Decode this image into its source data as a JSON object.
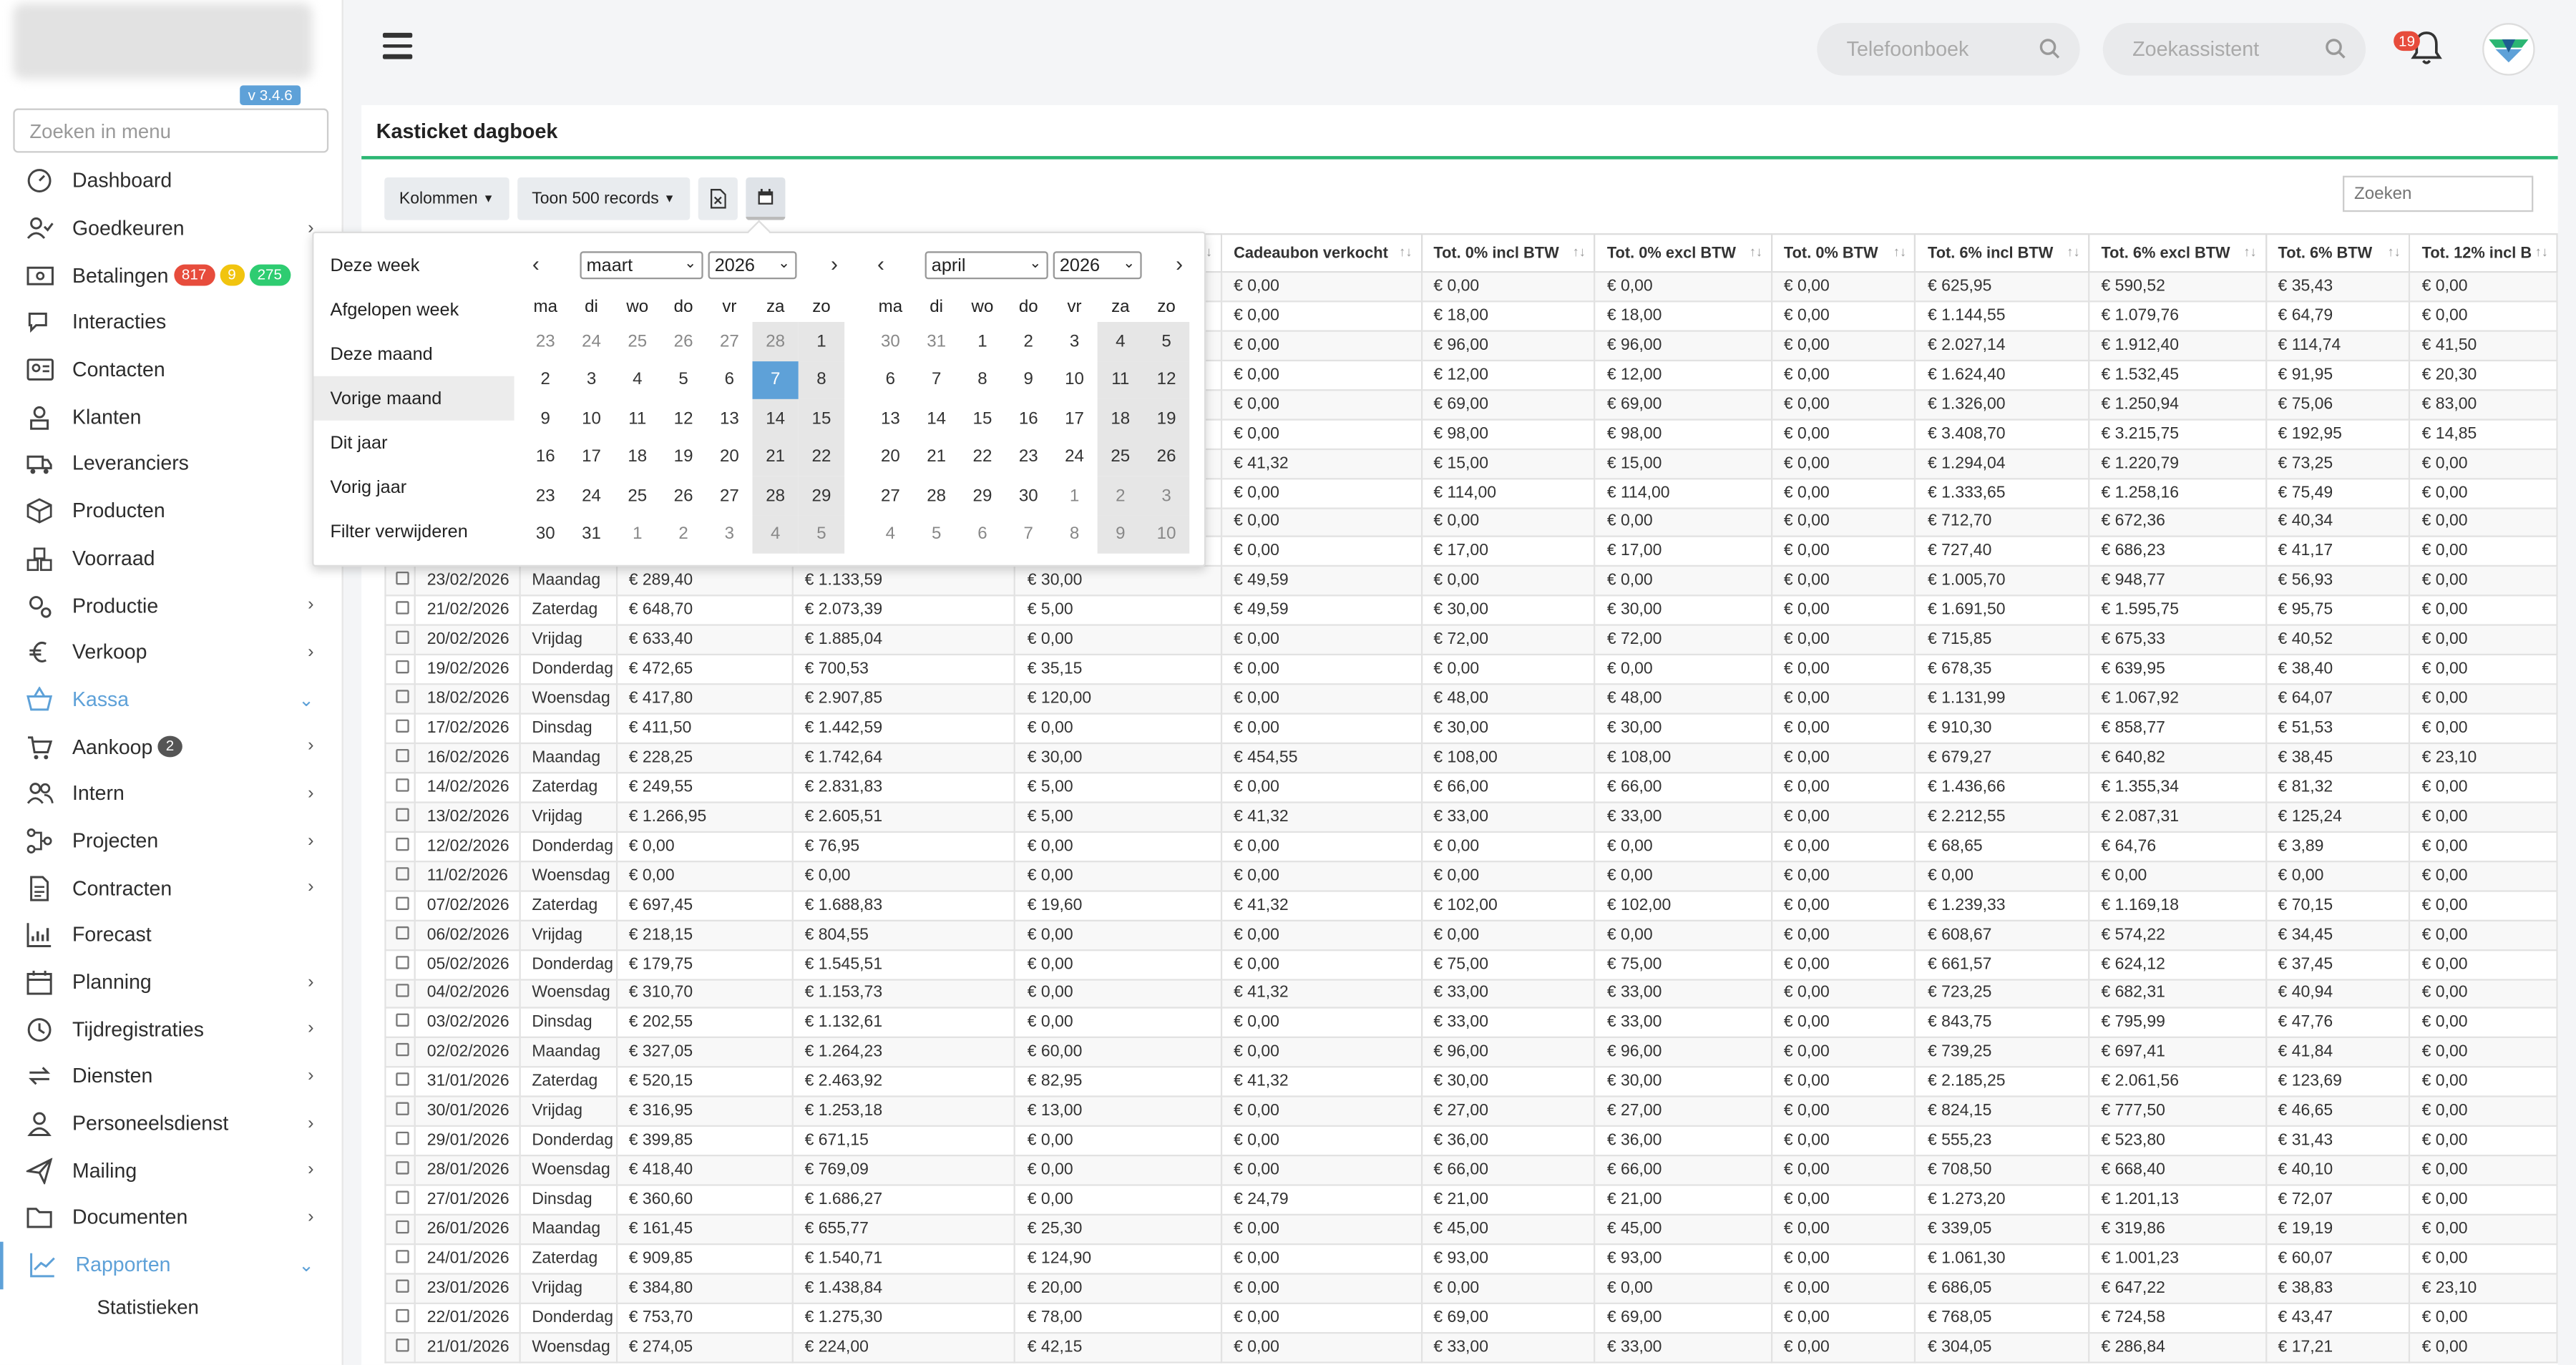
{
  "app": {
    "version": "v 3.4.6",
    "menu_search_placeholder": "Zoeken in menu"
  },
  "menu": [
    {
      "label": "Dashboard",
      "icon": "dashboard-icon"
    },
    {
      "label": "Goedkeuren",
      "icon": "user-check-icon",
      "chevron": true
    },
    {
      "label": "Betalingen",
      "icon": "money-icon",
      "badges": [
        {
          "text": "817",
          "color": "#e74c3c"
        },
        {
          "text": "9",
          "color": "#f1c40f"
        },
        {
          "text": "275",
          "color": "#2ecc71"
        }
      ]
    },
    {
      "label": "Interacties",
      "icon": "chat-icon"
    },
    {
      "label": "Contacten",
      "icon": "contact-card-icon"
    },
    {
      "label": "Klanten",
      "icon": "customer-icon"
    },
    {
      "label": "Leveranciers",
      "icon": "truck-icon"
    },
    {
      "label": "Producten",
      "icon": "box-icon"
    },
    {
      "label": "Voorraad",
      "icon": "stock-icon"
    },
    {
      "label": "Productie",
      "icon": "gears-icon",
      "chevron": true
    },
    {
      "label": "Verkoop",
      "icon": "euro-icon",
      "chevron": true
    },
    {
      "label": "Kassa",
      "icon": "basket-icon",
      "chevron": true,
      "active": true
    },
    {
      "label": "Aankoop",
      "icon": "cart-icon",
      "chevron": true,
      "badges": [
        {
          "text": "2",
          "color": "#555"
        }
      ]
    },
    {
      "label": "Intern",
      "icon": "users-icon",
      "chevron": true
    },
    {
      "label": "Projecten",
      "icon": "project-icon",
      "chevron": true
    },
    {
      "label": "Contracten",
      "icon": "contract-icon",
      "chevron": true
    },
    {
      "label": "Forecast",
      "icon": "chart-icon"
    },
    {
      "label": "Planning",
      "icon": "calendar-icon",
      "chevron": true
    },
    {
      "label": "Tijdregistraties",
      "icon": "clock-icon",
      "chevron": true
    },
    {
      "label": "Diensten",
      "icon": "sync-icon",
      "chevron": true
    },
    {
      "label": "Personeelsdienst",
      "icon": "person-icon",
      "chevron": true
    },
    {
      "label": "Mailing",
      "icon": "paper-plane-icon",
      "chevron": true
    },
    {
      "label": "Documenten",
      "icon": "folder-icon",
      "chevron": true
    },
    {
      "label": "Rapporten",
      "icon": "line-chart-icon",
      "chevron": true,
      "active": true,
      "current": true
    }
  ],
  "submenu": [
    "Statistieken"
  ],
  "topbar": {
    "phonebook_placeholder": "Telefoonboek",
    "assistant_placeholder": "Zoekassistent",
    "notifications": "19"
  },
  "panel": {
    "title": "Kasticket dagboek",
    "columns_btn": "Kolommen",
    "records_btn": "Toon 500 records",
    "search_placeholder": "Zoeken",
    "headers": [
      "",
      "",
      "",
      "",
      "",
      "",
      "Cadeaubon verkocht",
      "Tot. 0% incl BTW",
      "Tot. 0% excl BTW",
      "Tot. 0% BTW",
      "Tot. 6% incl BTW",
      "Tot. 6% excl BTW",
      "Tot. 6% BTW",
      "Tot. 12% incl B"
    ],
    "rows": [
      [
        "",
        "",
        "",
        "",
        "",
        "€ 0,00",
        "€ 0,00",
        "€ 0,00",
        "€ 0,00",
        "€ 625,95",
        "€ 590,52",
        "€ 35,43",
        "€ 0,00"
      ],
      [
        "",
        "",
        "",
        "",
        "",
        "€ 0,00",
        "€ 18,00",
        "€ 18,00",
        "€ 0,00",
        "€ 1.144,55",
        "€ 1.079,76",
        "€ 64,79",
        "€ 0,00"
      ],
      [
        "",
        "",
        "",
        "",
        "",
        "€ 0,00",
        "€ 96,00",
        "€ 96,00",
        "€ 0,00",
        "€ 2.027,14",
        "€ 1.912,40",
        "€ 114,74",
        "€ 41,50"
      ],
      [
        "",
        "",
        "",
        "",
        "",
        "€ 0,00",
        "€ 12,00",
        "€ 12,00",
        "€ 0,00",
        "€ 1.624,40",
        "€ 1.532,45",
        "€ 91,95",
        "€ 20,30"
      ],
      [
        "",
        "",
        "",
        "",
        "",
        "€ 0,00",
        "€ 69,00",
        "€ 69,00",
        "€ 0,00",
        "€ 1.326,00",
        "€ 1.250,94",
        "€ 75,06",
        "€ 83,00"
      ],
      [
        "",
        "",
        "",
        "",
        "",
        "€ 0,00",
        "€ 98,00",
        "€ 98,00",
        "€ 0,00",
        "€ 3.408,70",
        "€ 3.215,75",
        "€ 192,95",
        "€ 14,85"
      ],
      [
        "",
        "",
        "",
        "",
        "",
        "€ 41,32",
        "€ 15,00",
        "€ 15,00",
        "€ 0,00",
        "€ 1.294,04",
        "€ 1.220,79",
        "€ 73,25",
        "€ 0,00"
      ],
      [
        "",
        "",
        "",
        "",
        "",
        "€ 0,00",
        "€ 114,00",
        "€ 114,00",
        "€ 0,00",
        "€ 1.333,65",
        "€ 1.258,16",
        "€ 75,49",
        "€ 0,00"
      ],
      [
        "",
        "",
        "",
        "",
        "",
        "€ 0,00",
        "€ 0,00",
        "€ 0,00",
        "€ 0,00",
        "€ 712,70",
        "€ 672,36",
        "€ 40,34",
        "€ 0,00"
      ],
      [
        "",
        "",
        "",
        "",
        "",
        "€ 0,00",
        "€ 17,00",
        "€ 17,00",
        "€ 0,00",
        "€ 727,40",
        "€ 686,23",
        "€ 41,17",
        "€ 0,00"
      ],
      [
        "23/02/2026",
        "Maandag",
        "€ 289,40",
        "€ 1.133,59",
        "€ 30,00",
        "€ 49,59",
        "€ 0,00",
        "€ 0,00",
        "€ 0,00",
        "€ 1.005,70",
        "€ 948,77",
        "€ 56,93",
        "€ 0,00"
      ],
      [
        "21/02/2026",
        "Zaterdag",
        "€ 648,70",
        "€ 2.073,39",
        "€ 5,00",
        "€ 49,59",
        "€ 30,00",
        "€ 30,00",
        "€ 0,00",
        "€ 1.691,50",
        "€ 1.595,75",
        "€ 95,75",
        "€ 0,00"
      ],
      [
        "20/02/2026",
        "Vrijdag",
        "€ 633,40",
        "€ 1.885,04",
        "€ 0,00",
        "€ 0,00",
        "€ 72,00",
        "€ 72,00",
        "€ 0,00",
        "€ 715,85",
        "€ 675,33",
        "€ 40,52",
        "€ 0,00"
      ],
      [
        "19/02/2026",
        "Donderdag",
        "€ 472,65",
        "€ 700,53",
        "€ 35,15",
        "€ 0,00",
        "€ 0,00",
        "€ 0,00",
        "€ 0,00",
        "€ 678,35",
        "€ 639,95",
        "€ 38,40",
        "€ 0,00"
      ],
      [
        "18/02/2026",
        "Woensdag",
        "€ 417,80",
        "€ 2.907,85",
        "€ 120,00",
        "€ 0,00",
        "€ 48,00",
        "€ 48,00",
        "€ 0,00",
        "€ 1.131,99",
        "€ 1.067,92",
        "€ 64,07",
        "€ 0,00"
      ],
      [
        "17/02/2026",
        "Dinsdag",
        "€ 411,50",
        "€ 1.442,59",
        "€ 0,00",
        "€ 0,00",
        "€ 30,00",
        "€ 30,00",
        "€ 0,00",
        "€ 910,30",
        "€ 858,77",
        "€ 51,53",
        "€ 0,00"
      ],
      [
        "16/02/2026",
        "Maandag",
        "€ 228,25",
        "€ 1.742,64",
        "€ 30,00",
        "€ 454,55",
        "€ 108,00",
        "€ 108,00",
        "€ 0,00",
        "€ 679,27",
        "€ 640,82",
        "€ 38,45",
        "€ 23,10"
      ],
      [
        "14/02/2026",
        "Zaterdag",
        "€ 249,55",
        "€ 2.831,83",
        "€ 5,00",
        "€ 0,00",
        "€ 66,00",
        "€ 66,00",
        "€ 0,00",
        "€ 1.436,66",
        "€ 1.355,34",
        "€ 81,32",
        "€ 0,00"
      ],
      [
        "13/02/2026",
        "Vrijdag",
        "€ 1.266,95",
        "€ 2.605,51",
        "€ 5,00",
        "€ 41,32",
        "€ 33,00",
        "€ 33,00",
        "€ 0,00",
        "€ 2.212,55",
        "€ 2.087,31",
        "€ 125,24",
        "€ 0,00"
      ],
      [
        "12/02/2026",
        "Donderdag",
        "€ 0,00",
        "€ 76,95",
        "€ 0,00",
        "€ 0,00",
        "€ 0,00",
        "€ 0,00",
        "€ 0,00",
        "€ 68,65",
        "€ 64,76",
        "€ 3,89",
        "€ 0,00"
      ],
      [
        "11/02/2026",
        "Woensdag",
        "€ 0,00",
        "€ 0,00",
        "€ 0,00",
        "€ 0,00",
        "€ 0,00",
        "€ 0,00",
        "€ 0,00",
        "€ 0,00",
        "€ 0,00",
        "€ 0,00",
        "€ 0,00"
      ],
      [
        "07/02/2026",
        "Zaterdag",
        "€ 697,45",
        "€ 1.688,83",
        "€ 19,60",
        "€ 41,32",
        "€ 102,00",
        "€ 102,00",
        "€ 0,00",
        "€ 1.239,33",
        "€ 1.169,18",
        "€ 70,15",
        "€ 0,00"
      ],
      [
        "06/02/2026",
        "Vrijdag",
        "€ 218,15",
        "€ 804,55",
        "€ 0,00",
        "€ 0,00",
        "€ 0,00",
        "€ 0,00",
        "€ 0,00",
        "€ 608,67",
        "€ 574,22",
        "€ 34,45",
        "€ 0,00"
      ],
      [
        "05/02/2026",
        "Donderdag",
        "€ 179,75",
        "€ 1.545,51",
        "€ 0,00",
        "€ 0,00",
        "€ 75,00",
        "€ 75,00",
        "€ 0,00",
        "€ 661,57",
        "€ 624,12",
        "€ 37,45",
        "€ 0,00"
      ],
      [
        "04/02/2026",
        "Woensdag",
        "€ 310,70",
        "€ 1.153,73",
        "€ 0,00",
        "€ 41,32",
        "€ 33,00",
        "€ 33,00",
        "€ 0,00",
        "€ 723,25",
        "€ 682,31",
        "€ 40,94",
        "€ 0,00"
      ],
      [
        "03/02/2026",
        "Dinsdag",
        "€ 202,55",
        "€ 1.132,61",
        "€ 0,00",
        "€ 0,00",
        "€ 33,00",
        "€ 33,00",
        "€ 0,00",
        "€ 843,75",
        "€ 795,99",
        "€ 47,76",
        "€ 0,00"
      ],
      [
        "02/02/2026",
        "Maandag",
        "€ 327,05",
        "€ 1.264,23",
        "€ 60,00",
        "€ 0,00",
        "€ 96,00",
        "€ 96,00",
        "€ 0,00",
        "€ 739,25",
        "€ 697,41",
        "€ 41,84",
        "€ 0,00"
      ],
      [
        "31/01/2026",
        "Zaterdag",
        "€ 520,15",
        "€ 2.463,92",
        "€ 82,95",
        "€ 41,32",
        "€ 30,00",
        "€ 30,00",
        "€ 0,00",
        "€ 2.185,25",
        "€ 2.061,56",
        "€ 123,69",
        "€ 0,00"
      ],
      [
        "30/01/2026",
        "Vrijdag",
        "€ 316,95",
        "€ 1.253,18",
        "€ 13,00",
        "€ 0,00",
        "€ 27,00",
        "€ 27,00",
        "€ 0,00",
        "€ 824,15",
        "€ 777,50",
        "€ 46,65",
        "€ 0,00"
      ],
      [
        "29/01/2026",
        "Donderdag",
        "€ 399,85",
        "€ 671,15",
        "€ 0,00",
        "€ 0,00",
        "€ 36,00",
        "€ 36,00",
        "€ 0,00",
        "€ 555,23",
        "€ 523,80",
        "€ 31,43",
        "€ 0,00"
      ],
      [
        "28/01/2026",
        "Woensdag",
        "€ 418,40",
        "€ 769,09",
        "€ 0,00",
        "€ 0,00",
        "€ 66,00",
        "€ 66,00",
        "€ 0,00",
        "€ 708,50",
        "€ 668,40",
        "€ 40,10",
        "€ 0,00"
      ],
      [
        "27/01/2026",
        "Dinsdag",
        "€ 360,60",
        "€ 1.686,27",
        "€ 0,00",
        "€ 24,79",
        "€ 21,00",
        "€ 21,00",
        "€ 0,00",
        "€ 1.273,20",
        "€ 1.201,13",
        "€ 72,07",
        "€ 0,00"
      ],
      [
        "26/01/2026",
        "Maandag",
        "€ 161,45",
        "€ 655,77",
        "€ 25,30",
        "€ 0,00",
        "€ 45,00",
        "€ 45,00",
        "€ 0,00",
        "€ 339,05",
        "€ 319,86",
        "€ 19,19",
        "€ 0,00"
      ],
      [
        "24/01/2026",
        "Zaterdag",
        "€ 909,85",
        "€ 1.540,71",
        "€ 124,90",
        "€ 0,00",
        "€ 93,00",
        "€ 93,00",
        "€ 0,00",
        "€ 1.061,30",
        "€ 1.001,23",
        "€ 60,07",
        "€ 0,00"
      ],
      [
        "23/01/2026",
        "Vrijdag",
        "€ 384,80",
        "€ 1.438,84",
        "€ 20,00",
        "€ 0,00",
        "€ 0,00",
        "€ 0,00",
        "€ 0,00",
        "€ 686,05",
        "€ 647,22",
        "€ 38,83",
        "€ 23,10"
      ],
      [
        "22/01/2026",
        "Donderdag",
        "€ 753,70",
        "€ 1.275,30",
        "€ 78,00",
        "€ 0,00",
        "€ 69,00",
        "€ 69,00",
        "€ 0,00",
        "€ 768,05",
        "€ 724,58",
        "€ 43,47",
        "€ 0,00"
      ],
      [
        "21/01/2026",
        "Woensdag",
        "€ 274,05",
        "€ 224,00",
        "€ 42,15",
        "€ 0,00",
        "€ 33,00",
        "€ 33,00",
        "€ 0,00",
        "€ 304,05",
        "€ 286,84",
        "€ 17,21",
        "€ 0,00"
      ]
    ]
  },
  "datepicker": {
    "ranges": [
      "Deze week",
      "Afgelopen week",
      "Deze maand",
      "Vorige maand",
      "Dit jaar",
      "Vorig jaar",
      "Filter verwijderen"
    ],
    "active_range": "Vorige maand",
    "dow": [
      "ma",
      "di",
      "wo",
      "do",
      "vr",
      "za",
      "zo"
    ],
    "left": {
      "month": "maart",
      "year": "2026",
      "days": [
        "23",
        "24",
        "25",
        "26",
        "27",
        "28",
        "1",
        "2",
        "3",
        "4",
        "5",
        "6",
        "7",
        "8",
        "9",
        "10",
        "11",
        "12",
        "13",
        "14",
        "15",
        "16",
        "17",
        "18",
        "19",
        "20",
        "21",
        "22",
        "23",
        "24",
        "25",
        "26",
        "27",
        "28",
        "29",
        "30",
        "31",
        "1",
        "2",
        "3",
        "4",
        "5"
      ],
      "selected_index": 12
    },
    "right": {
      "month": "april",
      "year": "2026",
      "days": [
        "30",
        "31",
        "1",
        "2",
        "3",
        "4",
        "5",
        "6",
        "7",
        "8",
        "9",
        "10",
        "11",
        "12",
        "13",
        "14",
        "15",
        "16",
        "17",
        "18",
        "19",
        "20",
        "21",
        "22",
        "23",
        "24",
        "25",
        "26",
        "27",
        "28",
        "29",
        "30",
        "1",
        "2",
        "3",
        "4",
        "5",
        "6",
        "7",
        "8",
        "9",
        "10"
      ],
      "selected_index": -1
    }
  }
}
